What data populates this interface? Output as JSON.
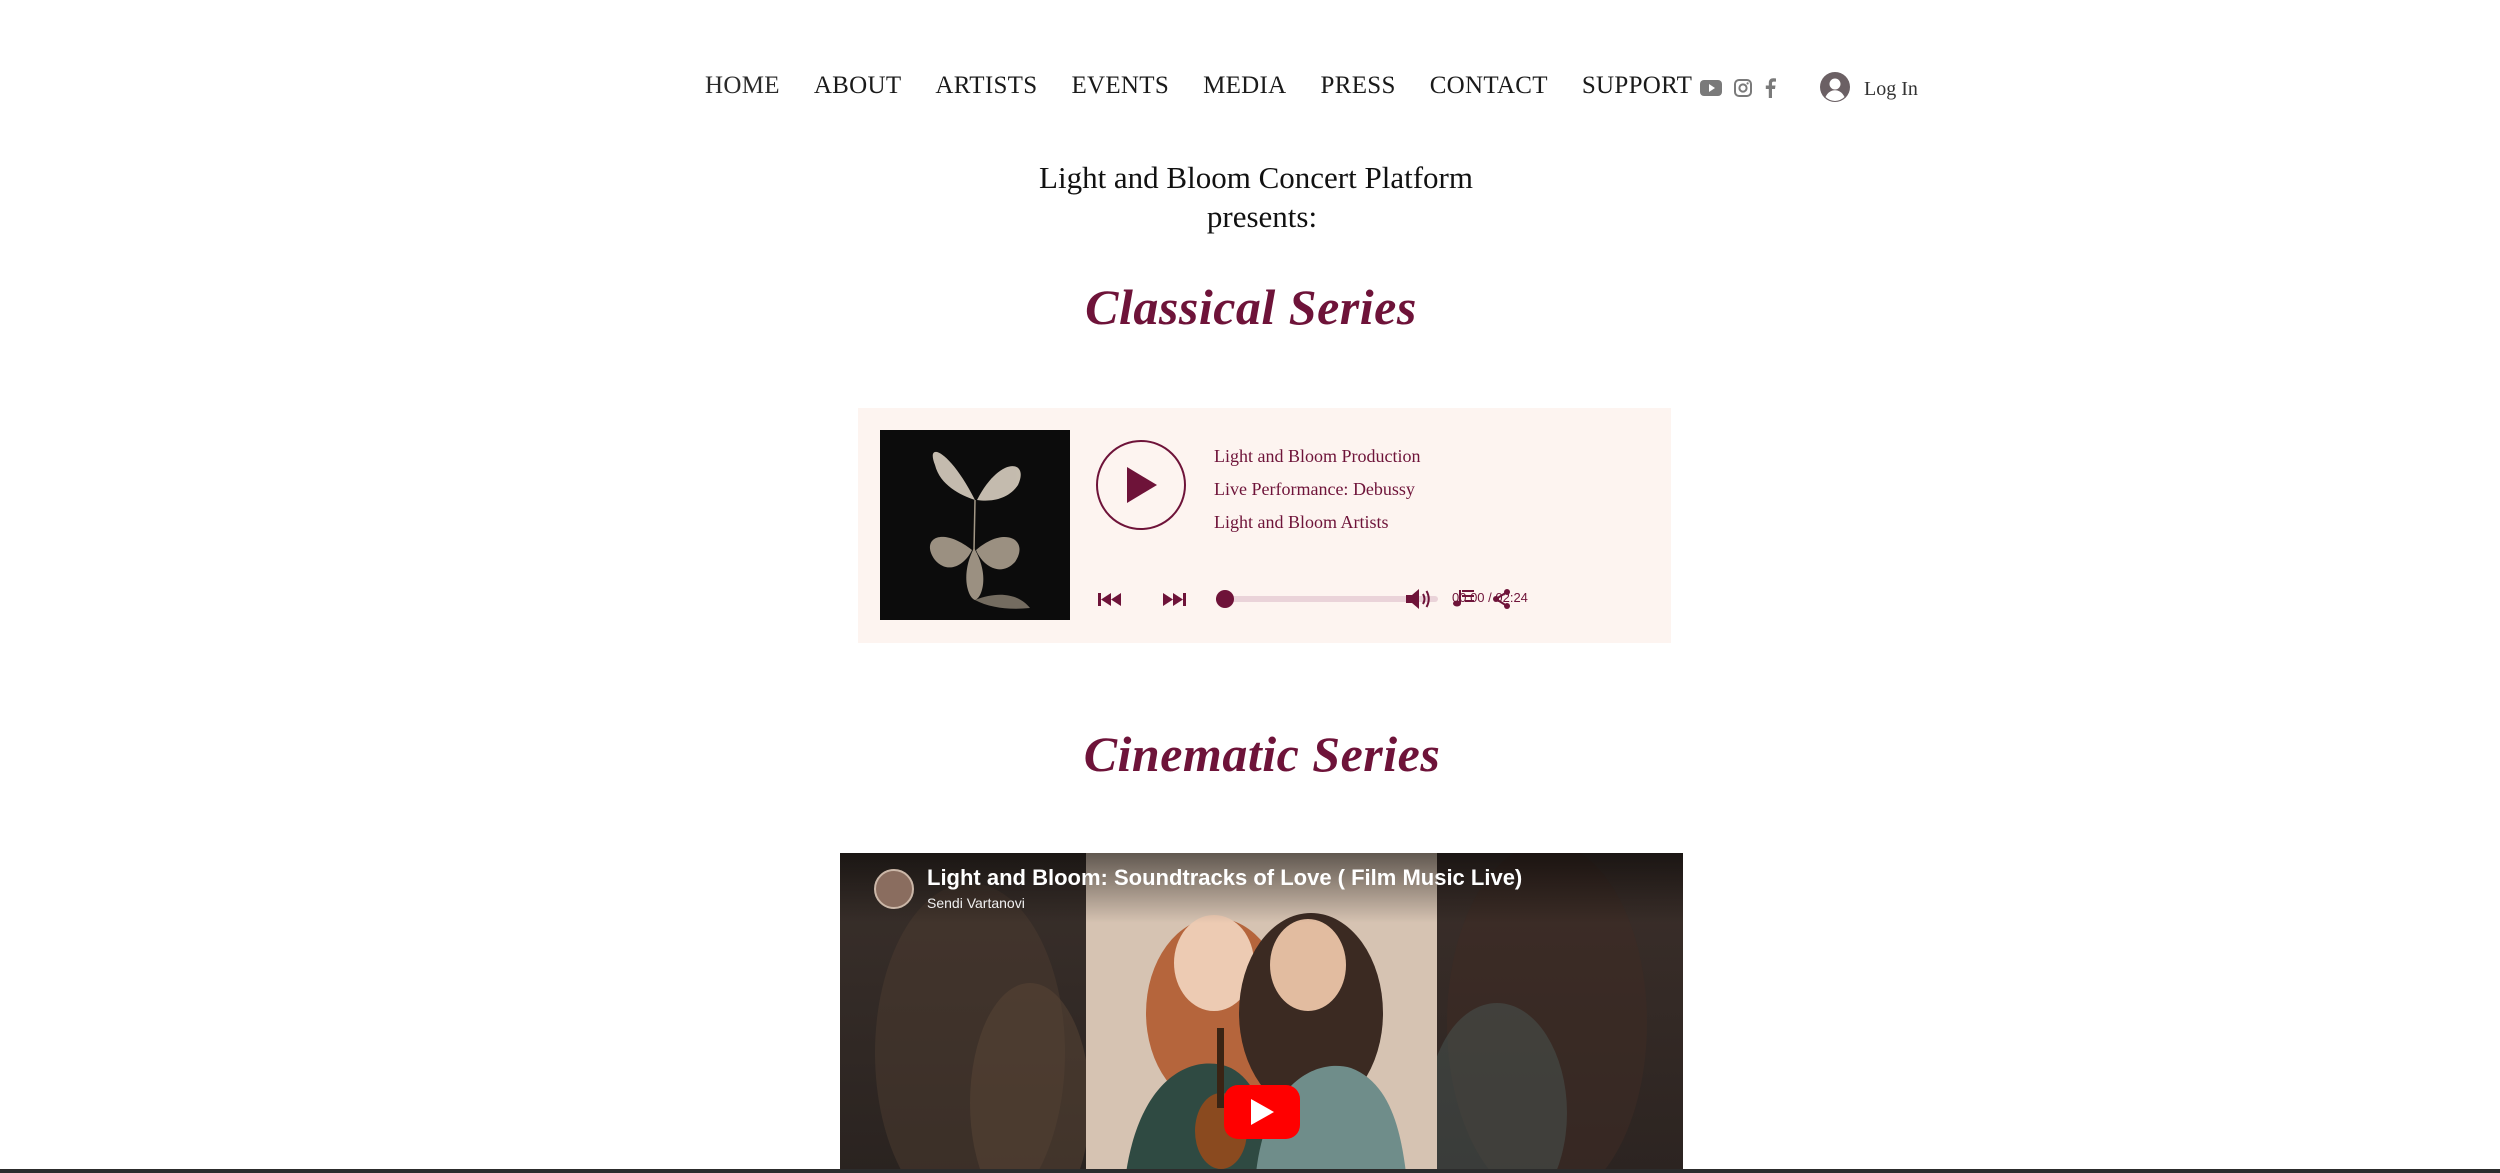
{
  "nav": {
    "items": [
      {
        "label": "HOME"
      },
      {
        "label": "ABOUT"
      },
      {
        "label": "ARTISTS"
      },
      {
        "label": "EVENTS"
      },
      {
        "label": "MEDIA"
      },
      {
        "label": "PRESS"
      },
      {
        "label": "CONTACT"
      },
      {
        "label": "SUPPORT"
      }
    ],
    "social_icons": [
      "youtube-icon",
      "instagram-icon",
      "facebook-icon"
    ],
    "login_label": "Log In"
  },
  "intro": {
    "line1": "Light and Bloom Concert Platform",
    "line2": "presents:"
  },
  "sections": {
    "classical_title": "Classical Series",
    "cinematic_title": "Cinematic Series"
  },
  "player": {
    "track_line1": "Light and Bloom Production",
    "track_line2": "Live Performance: Debussy",
    "track_line3": "Light and Bloom Artists",
    "current_time": "00:00",
    "duration": "02:24",
    "time_display": "00:00 / 02:24",
    "progress_fraction": 0.04
  },
  "video": {
    "title": "Light and Bloom: Soundtracks of Love ( Film Music Live)",
    "channel": "Sendi Vartanovi"
  },
  "colors": {
    "accent": "#6e1339",
    "player_bg": "#fdf4f0",
    "youtube_red": "#ff0000"
  }
}
